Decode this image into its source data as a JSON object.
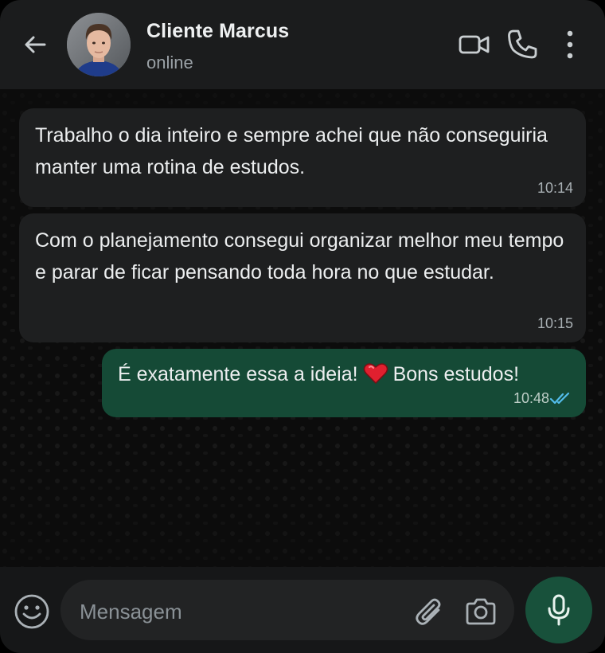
{
  "header": {
    "contact_name": "Cliente Marcus",
    "status": "online"
  },
  "messages": [
    {
      "direction": "incoming",
      "text": "Trabalho o dia inteiro e sempre achei que não conseguiria manter uma rotina de estudos.",
      "time": "10:14"
    },
    {
      "direction": "incoming",
      "text": "Com o planejamento consegui organizar melhor meu tempo e parar de ficar pensando toda hora no que estudar.",
      "time": "10:15"
    },
    {
      "direction": "outgoing",
      "text_before": "É exatamente essa a ideia!",
      "emoji": "red-heart",
      "text_after": "Bons estudos!",
      "time": "10:48",
      "status": "read"
    }
  ],
  "composer": {
    "placeholder": "Mensagem",
    "value": ""
  },
  "colors": {
    "header_bg": "#1b1c1d",
    "chat_bg": "#0c0c0c",
    "incoming_bubble": "#1e1f20",
    "outgoing_bubble": "#154a36",
    "mic_button": "#18513b",
    "read_ticks": "#53bdeb"
  },
  "icons": {
    "back": "arrow-left-icon",
    "video": "video-camera-icon",
    "call": "phone-icon",
    "menu": "more-vertical-icon",
    "emoji": "smiley-icon",
    "attach": "paperclip-icon",
    "camera": "camera-icon",
    "mic": "microphone-icon"
  }
}
